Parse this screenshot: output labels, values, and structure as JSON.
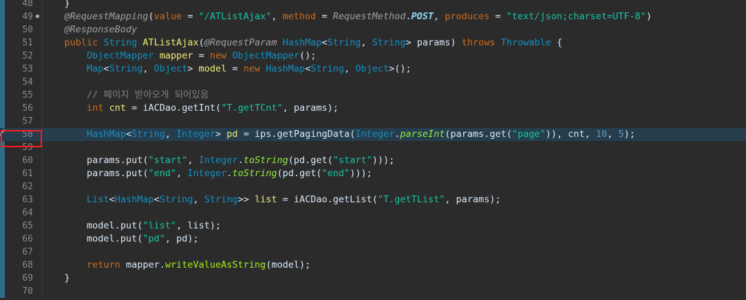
{
  "editor": {
    "highlight_line": "58",
    "lines": [
      {
        "n": "48",
        "bar": true,
        "fold": "",
        "tokens": [
          {
            "t": "    }",
            "c": "c-default"
          }
        ]
      },
      {
        "n": "49",
        "bar": true,
        "fold": "●",
        "tokens": [
          {
            "t": "    @RequestMapping",
            "c": "c-ann"
          },
          {
            "t": "(",
            "c": "c-default"
          },
          {
            "t": "value",
            "c": "c-kw"
          },
          {
            "t": " = ",
            "c": "c-default"
          },
          {
            "t": "\"/ATListAjax\"",
            "c": "c-str"
          },
          {
            "t": ", ",
            "c": "c-default"
          },
          {
            "t": "method",
            "c": "c-kw"
          },
          {
            "t": " = ",
            "c": "c-default"
          },
          {
            "t": "RequestMethod",
            "c": "c-ann"
          },
          {
            "t": ".",
            "c": "c-default"
          },
          {
            "t": "POST",
            "c": "c-field"
          },
          {
            "t": ", ",
            "c": "c-default"
          },
          {
            "t": "produces",
            "c": "c-kw"
          },
          {
            "t": " = ",
            "c": "c-default"
          },
          {
            "t": "\"text/json;charset=UTF-8\"",
            "c": "c-str"
          },
          {
            "t": ")",
            "c": "c-default"
          }
        ]
      },
      {
        "n": "50",
        "bar": true,
        "fold": "",
        "tokens": [
          {
            "t": "    @ResponseBody",
            "c": "c-ann"
          }
        ]
      },
      {
        "n": "51",
        "bar": true,
        "fold": "",
        "tokens": [
          {
            "t": "    ",
            "c": "c-default"
          },
          {
            "t": "public",
            "c": "c-kw"
          },
          {
            "t": " ",
            "c": "c-default"
          },
          {
            "t": "String",
            "c": "c-type"
          },
          {
            "t": " ",
            "c": "c-default"
          },
          {
            "t": "ATListAjax",
            "c": "c-var"
          },
          {
            "t": "(",
            "c": "c-default"
          },
          {
            "t": "@RequestParam",
            "c": "c-ann"
          },
          {
            "t": " ",
            "c": "c-default"
          },
          {
            "t": "HashMap",
            "c": "c-type"
          },
          {
            "t": "<",
            "c": "c-default"
          },
          {
            "t": "String",
            "c": "c-type"
          },
          {
            "t": ", ",
            "c": "c-default"
          },
          {
            "t": "String",
            "c": "c-type"
          },
          {
            "t": "> ",
            "c": "c-default"
          },
          {
            "t": "params",
            "c": "c-param"
          },
          {
            "t": ") ",
            "c": "c-default"
          },
          {
            "t": "throws",
            "c": "c-kw"
          },
          {
            "t": " ",
            "c": "c-default"
          },
          {
            "t": "Throwable",
            "c": "c-type"
          },
          {
            "t": " {",
            "c": "c-default"
          }
        ]
      },
      {
        "n": "52",
        "bar": true,
        "fold": "",
        "tokens": [
          {
            "t": "        ",
            "c": "c-default"
          },
          {
            "t": "ObjectMapper",
            "c": "c-type"
          },
          {
            "t": " ",
            "c": "c-default"
          },
          {
            "t": "mapper",
            "c": "c-var"
          },
          {
            "t": " = ",
            "c": "c-default"
          },
          {
            "t": "new",
            "c": "c-kw"
          },
          {
            "t": " ",
            "c": "c-default"
          },
          {
            "t": "ObjectMapper",
            "c": "c-type"
          },
          {
            "t": "();",
            "c": "c-default"
          }
        ]
      },
      {
        "n": "53",
        "bar": true,
        "fold": "",
        "tokens": [
          {
            "t": "        ",
            "c": "c-default"
          },
          {
            "t": "Map",
            "c": "c-type"
          },
          {
            "t": "<",
            "c": "c-default"
          },
          {
            "t": "String",
            "c": "c-type"
          },
          {
            "t": ", ",
            "c": "c-default"
          },
          {
            "t": "Object",
            "c": "c-type"
          },
          {
            "t": "> ",
            "c": "c-default"
          },
          {
            "t": "model",
            "c": "c-var"
          },
          {
            "t": " = ",
            "c": "c-default"
          },
          {
            "t": "new",
            "c": "c-kw"
          },
          {
            "t": " ",
            "c": "c-default"
          },
          {
            "t": "HashMap",
            "c": "c-type"
          },
          {
            "t": "<",
            "c": "c-default"
          },
          {
            "t": "String",
            "c": "c-type"
          },
          {
            "t": ", ",
            "c": "c-default"
          },
          {
            "t": "Object",
            "c": "c-type"
          },
          {
            "t": ">();",
            "c": "c-default"
          }
        ]
      },
      {
        "n": "54",
        "bar": true,
        "fold": "",
        "tokens": [
          {
            "t": "",
            "c": "c-default"
          }
        ]
      },
      {
        "n": "55",
        "bar": true,
        "fold": "",
        "tokens": [
          {
            "t": "        // 페이지 받아오게 되어있음",
            "c": "c-com"
          }
        ]
      },
      {
        "n": "56",
        "bar": true,
        "fold": "",
        "tokens": [
          {
            "t": "        ",
            "c": "c-default"
          },
          {
            "t": "int",
            "c": "c-kw"
          },
          {
            "t": " ",
            "c": "c-default"
          },
          {
            "t": "cnt",
            "c": "c-var"
          },
          {
            "t": " = ",
            "c": "c-default"
          },
          {
            "t": "iACDao",
            "c": "c-default"
          },
          {
            "t": ".",
            "c": "c-default"
          },
          {
            "t": "getInt",
            "c": "c-default"
          },
          {
            "t": "(",
            "c": "c-default"
          },
          {
            "t": "\"T.getTCnt\"",
            "c": "c-str"
          },
          {
            "t": ", ",
            "c": "c-default"
          },
          {
            "t": "params",
            "c": "c-param"
          },
          {
            "t": ");",
            "c": "c-default"
          }
        ]
      },
      {
        "n": "57",
        "bar": true,
        "fold": "",
        "tokens": [
          {
            "t": "",
            "c": "c-default"
          }
        ]
      },
      {
        "n": "58",
        "bar": false,
        "current": true,
        "bp": true,
        "fold": "",
        "tokens": [
          {
            "t": "        ",
            "c": "c-default"
          },
          {
            "t": "HashMap",
            "c": "c-type"
          },
          {
            "t": "<",
            "c": "c-default"
          },
          {
            "t": "String",
            "c": "c-type"
          },
          {
            "t": ", ",
            "c": "c-default"
          },
          {
            "t": "Integer",
            "c": "c-type"
          },
          {
            "t": "> ",
            "c": "c-default"
          },
          {
            "t": "pd",
            "c": "c-var"
          },
          {
            "t": " = ",
            "c": "c-default"
          },
          {
            "t": "ips",
            "c": "c-default"
          },
          {
            "t": ".",
            "c": "c-default"
          },
          {
            "t": "getPagingData",
            "c": "c-default"
          },
          {
            "t": "(",
            "c": "c-default"
          },
          {
            "t": "Integer",
            "c": "c-type"
          },
          {
            "t": ".",
            "c": "c-default"
          },
          {
            "t": "parseInt",
            "c": "c-static"
          },
          {
            "t": "(",
            "c": "c-default"
          },
          {
            "t": "params",
            "c": "c-param"
          },
          {
            "t": ".",
            "c": "c-default"
          },
          {
            "t": "get",
            "c": "c-default"
          },
          {
            "t": "(",
            "c": "c-default"
          },
          {
            "t": "\"page\"",
            "c": "c-str"
          },
          {
            "t": ")), ",
            "c": "c-default"
          },
          {
            "t": "cnt",
            "c": "c-default"
          },
          {
            "t": ", ",
            "c": "c-default"
          },
          {
            "t": "10",
            "c": "c-num"
          },
          {
            "t": ", ",
            "c": "c-default"
          },
          {
            "t": "5",
            "c": "c-num"
          },
          {
            "t": ");",
            "c": "c-default"
          }
        ]
      },
      {
        "n": "59",
        "bar": true,
        "fold": "",
        "tokens": [
          {
            "t": "",
            "c": "c-default"
          }
        ]
      },
      {
        "n": "60",
        "bar": true,
        "fold": "",
        "tokens": [
          {
            "t": "        ",
            "c": "c-default"
          },
          {
            "t": "params",
            "c": "c-param"
          },
          {
            "t": ".",
            "c": "c-default"
          },
          {
            "t": "put",
            "c": "c-default"
          },
          {
            "t": "(",
            "c": "c-default"
          },
          {
            "t": "\"start\"",
            "c": "c-str"
          },
          {
            "t": ", ",
            "c": "c-default"
          },
          {
            "t": "Integer",
            "c": "c-type"
          },
          {
            "t": ".",
            "c": "c-default"
          },
          {
            "t": "toString",
            "c": "c-static"
          },
          {
            "t": "(",
            "c": "c-default"
          },
          {
            "t": "pd",
            "c": "c-default"
          },
          {
            "t": ".",
            "c": "c-default"
          },
          {
            "t": "get",
            "c": "c-default"
          },
          {
            "t": "(",
            "c": "c-default"
          },
          {
            "t": "\"start\"",
            "c": "c-str"
          },
          {
            "t": ")));",
            "c": "c-default"
          }
        ]
      },
      {
        "n": "61",
        "bar": true,
        "fold": "",
        "tokens": [
          {
            "t": "        ",
            "c": "c-default"
          },
          {
            "t": "params",
            "c": "c-param"
          },
          {
            "t": ".",
            "c": "c-default"
          },
          {
            "t": "put",
            "c": "c-default"
          },
          {
            "t": "(",
            "c": "c-default"
          },
          {
            "t": "\"end\"",
            "c": "c-str"
          },
          {
            "t": ", ",
            "c": "c-default"
          },
          {
            "t": "Integer",
            "c": "c-type"
          },
          {
            "t": ".",
            "c": "c-default"
          },
          {
            "t": "toString",
            "c": "c-static"
          },
          {
            "t": "(",
            "c": "c-default"
          },
          {
            "t": "pd",
            "c": "c-default"
          },
          {
            "t": ".",
            "c": "c-default"
          },
          {
            "t": "get",
            "c": "c-default"
          },
          {
            "t": "(",
            "c": "c-default"
          },
          {
            "t": "\"end\"",
            "c": "c-str"
          },
          {
            "t": ")));",
            "c": "c-default"
          }
        ]
      },
      {
        "n": "62",
        "bar": true,
        "fold": "",
        "tokens": [
          {
            "t": "",
            "c": "c-default"
          }
        ]
      },
      {
        "n": "63",
        "bar": true,
        "fold": "",
        "tokens": [
          {
            "t": "        ",
            "c": "c-default"
          },
          {
            "t": "List",
            "c": "c-type"
          },
          {
            "t": "<",
            "c": "c-default"
          },
          {
            "t": "HashMap",
            "c": "c-type"
          },
          {
            "t": "<",
            "c": "c-default"
          },
          {
            "t": "String",
            "c": "c-type"
          },
          {
            "t": ", ",
            "c": "c-default"
          },
          {
            "t": "String",
            "c": "c-type"
          },
          {
            "t": ">> ",
            "c": "c-default"
          },
          {
            "t": "list",
            "c": "c-var"
          },
          {
            "t": " = ",
            "c": "c-default"
          },
          {
            "t": "iACDao",
            "c": "c-default"
          },
          {
            "t": ".",
            "c": "c-default"
          },
          {
            "t": "getList",
            "c": "c-default"
          },
          {
            "t": "(",
            "c": "c-default"
          },
          {
            "t": "\"T.getTList\"",
            "c": "c-str"
          },
          {
            "t": ", ",
            "c": "c-default"
          },
          {
            "t": "params",
            "c": "c-param"
          },
          {
            "t": ");",
            "c": "c-default"
          }
        ]
      },
      {
        "n": "64",
        "bar": true,
        "fold": "",
        "tokens": [
          {
            "t": "",
            "c": "c-default"
          }
        ]
      },
      {
        "n": "65",
        "bar": true,
        "fold": "",
        "tokens": [
          {
            "t": "        ",
            "c": "c-default"
          },
          {
            "t": "model",
            "c": "c-default"
          },
          {
            "t": ".",
            "c": "c-default"
          },
          {
            "t": "put",
            "c": "c-default"
          },
          {
            "t": "(",
            "c": "c-default"
          },
          {
            "t": "\"list\"",
            "c": "c-str"
          },
          {
            "t": ", ",
            "c": "c-default"
          },
          {
            "t": "list",
            "c": "c-default"
          },
          {
            "t": ");",
            "c": "c-default"
          }
        ]
      },
      {
        "n": "66",
        "bar": true,
        "fold": "",
        "tokens": [
          {
            "t": "        ",
            "c": "c-default"
          },
          {
            "t": "model",
            "c": "c-default"
          },
          {
            "t": ".",
            "c": "c-default"
          },
          {
            "t": "put",
            "c": "c-default"
          },
          {
            "t": "(",
            "c": "c-default"
          },
          {
            "t": "\"pd\"",
            "c": "c-str"
          },
          {
            "t": ", ",
            "c": "c-default"
          },
          {
            "t": "pd",
            "c": "c-default"
          },
          {
            "t": ");",
            "c": "c-default"
          }
        ]
      },
      {
        "n": "67",
        "bar": true,
        "fold": "",
        "tokens": [
          {
            "t": "",
            "c": "c-default"
          }
        ]
      },
      {
        "n": "68",
        "bar": true,
        "fold": "",
        "tokens": [
          {
            "t": "        ",
            "c": "c-default"
          },
          {
            "t": "return",
            "c": "c-kw"
          },
          {
            "t": " ",
            "c": "c-default"
          },
          {
            "t": "mapper",
            "c": "c-default"
          },
          {
            "t": ".",
            "c": "c-default"
          },
          {
            "t": "writeValueAsString",
            "c": "c-method"
          },
          {
            "t": "(",
            "c": "c-default"
          },
          {
            "t": "model",
            "c": "c-default"
          },
          {
            "t": ");",
            "c": "c-default"
          }
        ]
      },
      {
        "n": "69",
        "bar": true,
        "fold": "",
        "tokens": [
          {
            "t": "    }",
            "c": "c-default"
          }
        ]
      },
      {
        "n": "70",
        "bar": true,
        "fold": "",
        "tokens": [
          {
            "t": "",
            "c": "c-default"
          }
        ]
      }
    ]
  },
  "colors": {
    "background": "#2b2b2b",
    "current_line": "#263d4d",
    "change_bar": "#2f6d8a",
    "highlight_box": "#ff1b1b"
  },
  "icons": {
    "breakpoint": "breakpoint-icon",
    "fold": "fold-toggle-icon"
  }
}
